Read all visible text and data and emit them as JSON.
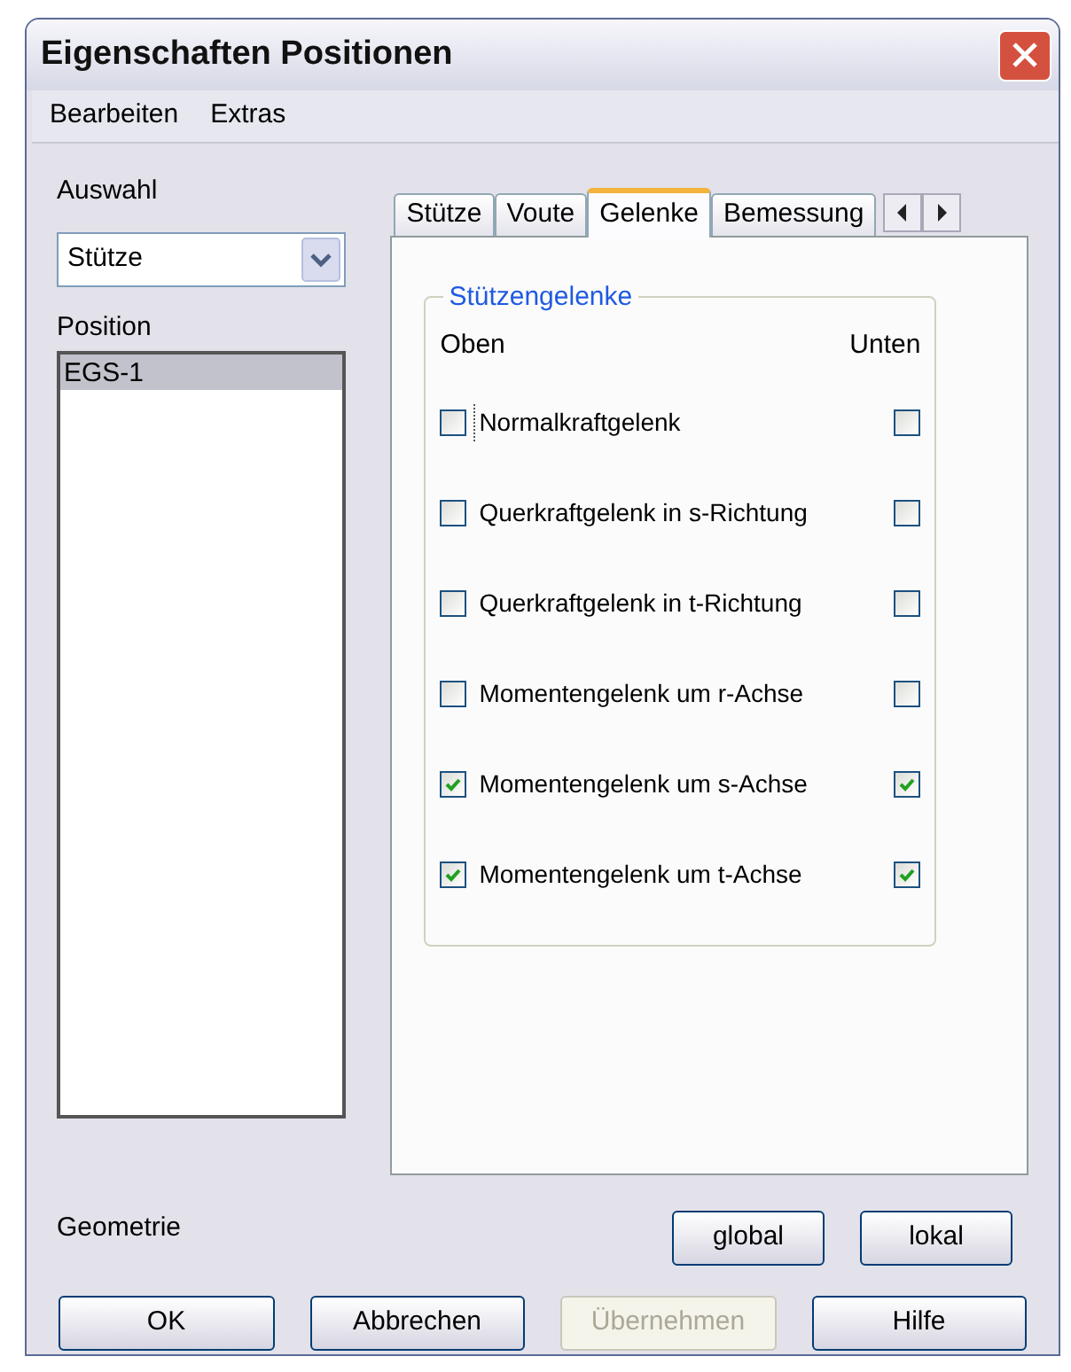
{
  "window": {
    "title": "Eigenschaften Positionen"
  },
  "menu": [
    "Bearbeiten",
    "Extras"
  ],
  "auswahl": {
    "label": "Auswahl",
    "value": "Stütze"
  },
  "position": {
    "label": "Position",
    "items": [
      {
        "label": "EGS-1",
        "selected": true
      }
    ]
  },
  "tabs": [
    {
      "label": "Stütze",
      "selected": false
    },
    {
      "label": "Voute",
      "selected": false
    },
    {
      "label": "Gelenke",
      "selected": true
    },
    {
      "label": "Bemessung",
      "selected": false
    }
  ],
  "group": {
    "title": "Stützengelenke",
    "col_top": "Oben",
    "col_bottom": "Unten",
    "rows": [
      {
        "label": "Normalkraftgelenk",
        "top": false,
        "bottom": false,
        "focused": true
      },
      {
        "label": "Querkraftgelenk in s-Richtung",
        "top": false,
        "bottom": false,
        "focused": false
      },
      {
        "label": "Querkraftgelenk in t-Richtung",
        "top": false,
        "bottom": false,
        "focused": false
      },
      {
        "label": "Momentengelenk um r-Achse",
        "top": false,
        "bottom": false,
        "focused": false
      },
      {
        "label": "Momentengelenk um s-Achse",
        "top": true,
        "bottom": true,
        "focused": false
      },
      {
        "label": "Momentengelenk um t-Achse",
        "top": true,
        "bottom": true,
        "focused": false
      }
    ]
  },
  "geometrie": {
    "label": "Geometrie",
    "buttons": [
      "global",
      "lokal"
    ]
  },
  "buttons": [
    {
      "label": "OK",
      "disabled": false
    },
    {
      "label": "Abbrechen",
      "disabled": false
    },
    {
      "label": "Übernehmen",
      "disabled": true
    },
    {
      "label": "Hilfe",
      "disabled": false
    }
  ]
}
